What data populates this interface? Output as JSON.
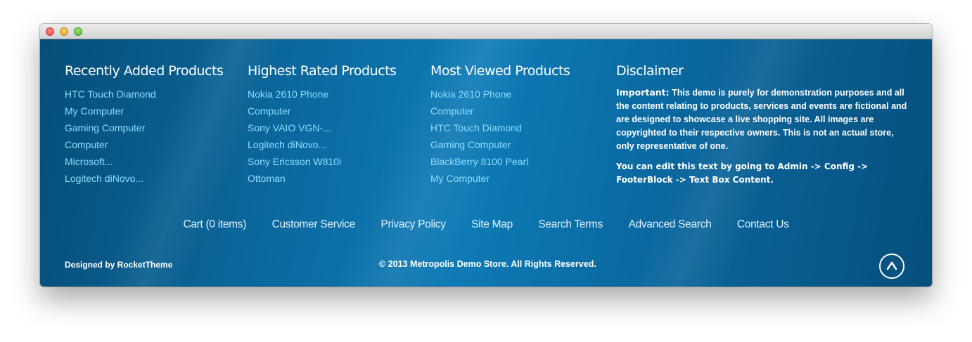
{
  "columns": [
    {
      "title": "Recently Added Products",
      "items": [
        "HTC Touch Diamond",
        "My Computer",
        "Gaming Computer",
        "Computer",
        "Microsoft...",
        "Logitech diNovo..."
      ]
    },
    {
      "title": "Highest Rated Products",
      "items": [
        "Nokia 2610 Phone",
        "Computer",
        "Sony VAIO VGN-...",
        "Logitech diNovo...",
        "Sony Ericsson W810i",
        "Ottoman"
      ]
    },
    {
      "title": "Most Viewed Products",
      "items": [
        "Nokia 2610 Phone",
        "Computer",
        "HTC Touch Diamond",
        "Gaming Computer",
        "BlackBerry 8100 Pearl",
        "My Computer"
      ]
    }
  ],
  "disclaimer": {
    "title": "Disclaimer",
    "lead": "Important:",
    "text": " This demo is purely for demonstration purposes and all the content relating to products, services and events are fictional and are designed to showcase a live shopping site. All images are copyrighted to their respective owners. This is not an actual store, only representative of one.",
    "edit_note": "You can edit this text by going to Admin -> Config -> FooterBlock -> Text Box Content."
  },
  "footer_nav": [
    "Cart (0 items)",
    "Customer Service",
    "Privacy Policy",
    "Site Map",
    "Search Terms",
    "Advanced Search",
    "Contact Us"
  ],
  "designed_by": "Designed by RocketTheme",
  "copyright": "© 2013 Metropolis Demo Store. All Rights Reserved.",
  "icons": {
    "window_controls": [
      "close-icon",
      "minimize-icon",
      "maximize-icon"
    ],
    "back_to_top": "chevron-up-icon"
  },
  "colors": {
    "background": "#0b6aa0",
    "link": "#8fdcff",
    "heading": "#ffffff"
  }
}
